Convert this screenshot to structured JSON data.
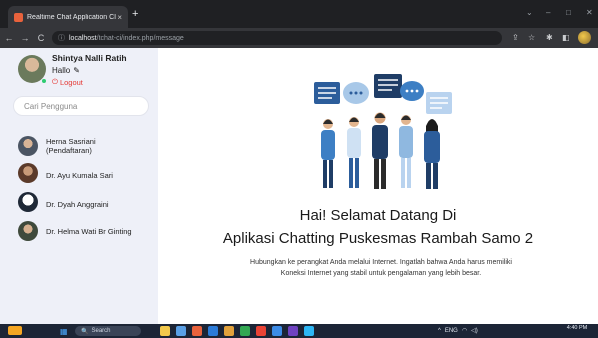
{
  "browser": {
    "tab_title": "Realtime Chat Application CI",
    "tab_close": "×",
    "new_tab": "+",
    "back": "←",
    "forward": "→",
    "reload": "C",
    "info": "ⓘ",
    "url_host": "localhost",
    "url_path": "/tchat-ci/index.php/message",
    "win_min": "–",
    "win_max": "□",
    "win_close": "✕",
    "win_chevron": "⌄",
    "share": "⇪",
    "star": "☆",
    "extensions": "✱",
    "sidepanel": "◧"
  },
  "profile": {
    "name": "Shintya Nalli Ratih",
    "status": "Hallo",
    "edit_glyph": "✎",
    "power_glyph": "⏻",
    "logout_label": "Logout"
  },
  "search": {
    "placeholder": "Cari Pengguna"
  },
  "contacts": [
    {
      "name": "Herna Sasriani (Pendaftaran)"
    },
    {
      "name": "Dr. Ayu Kumala Sari"
    },
    {
      "name": "Dr. Dyah Anggraini"
    },
    {
      "name": "Dr. Helma Wati Br Ginting"
    }
  ],
  "welcome": {
    "line1": "Hai! Selamat Datang Di",
    "line2": "Aplikasi Chatting Puskesmas Rambah Samo 2",
    "description": "Hubungkan ke perangkat Anda melalui Internet. Ingatlah bahwa Anda harus memiliki Koneksi Internet yang stabil untuk pengalaman yang lebih besar."
  },
  "taskbar": {
    "start_glyph": "▦",
    "search_glyph": "🔍",
    "search_label": "Search",
    "tray_chevron": "^",
    "lang": "ENG",
    "wifi": "◠",
    "volume": "◁)",
    "time": "4:40 PM"
  },
  "colors": {
    "sidebar_bg": "#eef0f8",
    "logout": "#e53935",
    "online": "#2ecc71",
    "illustration_blue": "#2c5d9b"
  }
}
